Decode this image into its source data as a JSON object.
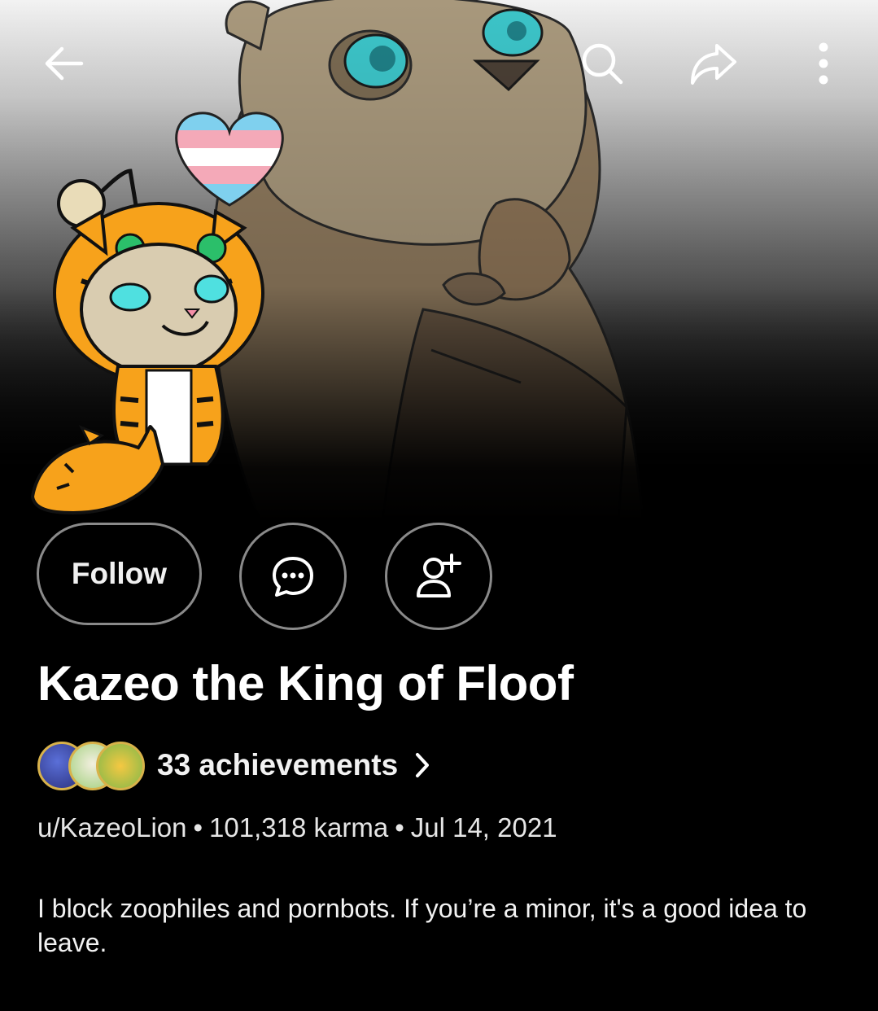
{
  "topbar": {
    "back_icon": "arrow-left-icon",
    "search_icon": "search-icon",
    "share_icon": "share-icon",
    "more_icon": "more-vertical-icon"
  },
  "banner": {
    "description_icon": "lion-banner-art"
  },
  "avatar": {
    "icon": "tiger-snoo-avatar",
    "accessory_icon": "trans-heart-icon"
  },
  "actions": {
    "follow_label": "Follow",
    "chat_icon": "chat-bubble-icon",
    "add_friend_icon": "add-user-icon"
  },
  "profile": {
    "display_name": "Kazeo the King of Floof",
    "achievements_label": "33 achievements",
    "username": "u/KazeoLion",
    "karma": "101,318 karma",
    "joined": "Jul 14, 2021",
    "separator": "•",
    "bio": "I block zoophiles and pornbots. If you’re a minor, it's a good idea to leave."
  },
  "colors": {
    "background": "#000000",
    "button_border": "#8a8a8a",
    "text_primary": "#ffffff",
    "badge_ring": "#d8b24a"
  }
}
